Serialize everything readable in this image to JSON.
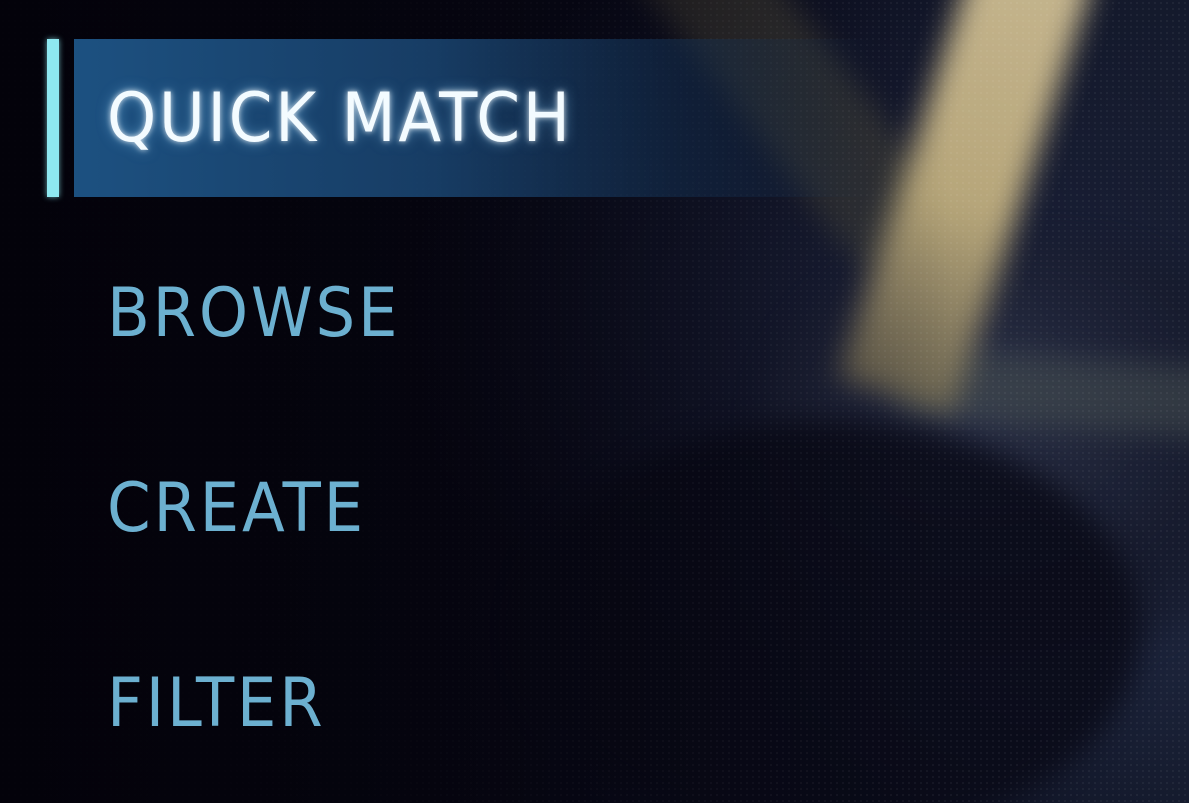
{
  "menu": {
    "items": [
      {
        "label": "QUICK MATCH",
        "active": true
      },
      {
        "label": "BROWSE",
        "active": false
      },
      {
        "label": "CREATE",
        "active": false
      },
      {
        "label": "FILTER",
        "active": false
      }
    ]
  },
  "colors": {
    "active_text": "#f3fbff",
    "inactive_text": "#6cb0d0",
    "active_bar": "#8ee8f0",
    "active_highlight": "#1e5587"
  }
}
